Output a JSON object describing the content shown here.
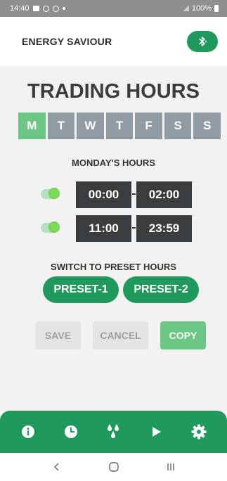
{
  "status_bar": {
    "time": "14:40",
    "battery": "100%"
  },
  "header": {
    "title": "ENERGY SAVIOUR",
    "bluetooth_icon": "bluetooth-icon"
  },
  "main": {
    "heading": "TRADING HOURS",
    "days": [
      {
        "label": "M",
        "active": true
      },
      {
        "label": "T",
        "active": false
      },
      {
        "label": "W",
        "active": false
      },
      {
        "label": "T",
        "active": false
      },
      {
        "label": "F",
        "active": false
      },
      {
        "label": "S",
        "active": false
      },
      {
        "label": "S",
        "active": false
      }
    ],
    "subheading": "MONDAY'S HOURS",
    "hours": [
      {
        "enabled": true,
        "start": "00:00",
        "end": "02:00"
      },
      {
        "enabled": true,
        "start": "11:00",
        "end": "23:59"
      }
    ],
    "preset_label": "SWITCH TO PRESET HOURS",
    "presets": [
      "PRESET-1",
      "PRESET-2"
    ],
    "actions": {
      "save": "SAVE",
      "cancel": "CANCEL",
      "copy": "COPY"
    }
  },
  "bottom_nav": [
    "info-icon",
    "clock-icon",
    "water-drops-icon",
    "play-icon",
    "gear-icon"
  ],
  "system_nav": [
    "back-icon",
    "home-icon",
    "recents-icon"
  ],
  "colors": {
    "brand_green": "#1f9a5c",
    "active_day": "#6cc784",
    "inactive_day": "#919ba4",
    "time_box": "#3a3d40"
  }
}
